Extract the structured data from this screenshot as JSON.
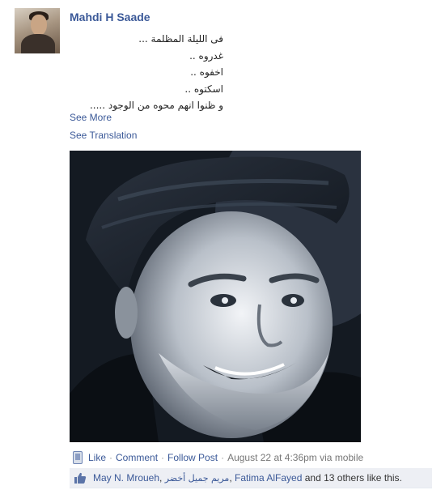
{
  "post": {
    "author": "Mahdi H Saade",
    "lines": [
      "فى الليلة المظلمة ...",
      "غدروه ..",
      "اخفوه ..",
      "اسكتوه ..",
      "و ظنوا انهم محوه من الوجود ....."
    ],
    "see_more": "See More",
    "see_translation": "See Translation"
  },
  "actions": {
    "like": "Like",
    "comment": "Comment",
    "follow": "Follow Post",
    "separator": "·",
    "timestamp": "August 22 at 4:36pm via mobile"
  },
  "likes": {
    "user1": "May N. Mroueh",
    "comma": ",",
    "user2": "مريم جميل أخضر",
    "user3": "Fatima AlFayed",
    "suffix": "and 13 others like this."
  },
  "colors": {
    "link": "#3b5998",
    "likes_bar_bg": "#edeff4",
    "meta": "#777777"
  }
}
